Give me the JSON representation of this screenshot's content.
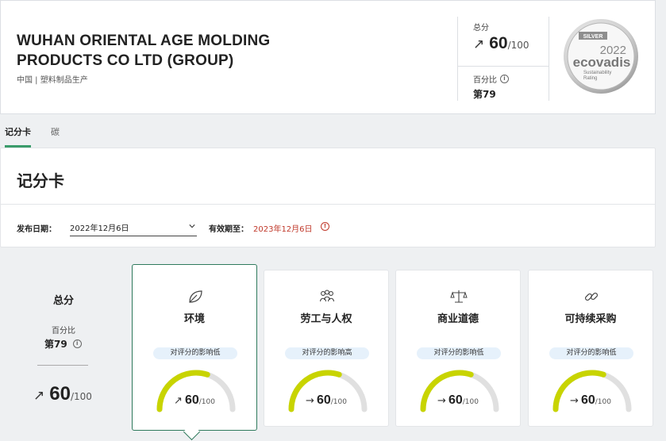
{
  "company": {
    "name": "WUHAN ORIENTAL AGE MOLDING PRODUCTS CO LTD (GROUP)",
    "subtitle": "中国 | 塑料制品生产"
  },
  "header_score": {
    "total_label": "总分",
    "score": "60",
    "denominator": "/100",
    "trend_icon": "arrow-up-right-icon",
    "percentile_label": "百分比",
    "rank": "第79"
  },
  "medal": {
    "tier": "SILVER",
    "year": "2022",
    "brand": "ecovadis",
    "caption1": "Sustainability",
    "caption2": "Rating"
  },
  "tabs": [
    {
      "label": "记分卡",
      "active": true
    },
    {
      "label": "碳",
      "active": false
    }
  ],
  "scorecard": {
    "title": "记分卡",
    "published_label": "发布日期：",
    "published_value": "2022年12月6日",
    "valid_label": "有效期至：",
    "valid_value": "2023年12月6日"
  },
  "overall": {
    "title": "总分",
    "percentile_label": "百分比",
    "rank": "第79",
    "score": "60",
    "denominator": "/100"
  },
  "themes": [
    {
      "name": "环境",
      "icon": "leaf-icon",
      "impact": "对评分的影响低",
      "score": "60",
      "denominator": "/100",
      "trend": "↗",
      "fraction": 0.6
    },
    {
      "name": "劳工与人权",
      "icon": "people-icon",
      "impact": "对评分的影响高",
      "score": "60",
      "denominator": "/100",
      "trend": "→",
      "fraction": 0.6
    },
    {
      "name": "商业道德",
      "icon": "scales-icon",
      "impact": "对评分的影响低",
      "score": "60",
      "denominator": "/100",
      "trend": "→",
      "fraction": 0.6
    },
    {
      "name": "可持续采购",
      "icon": "link-icon",
      "impact": "对评分的影响低",
      "score": "60",
      "denominator": "/100",
      "trend": "→",
      "fraction": 0.6
    }
  ],
  "colors": {
    "gauge_fill": "#c8d400",
    "gauge_track": "#e0e0e0",
    "accent": "#3a9b6a",
    "warning": "#c0392b"
  }
}
